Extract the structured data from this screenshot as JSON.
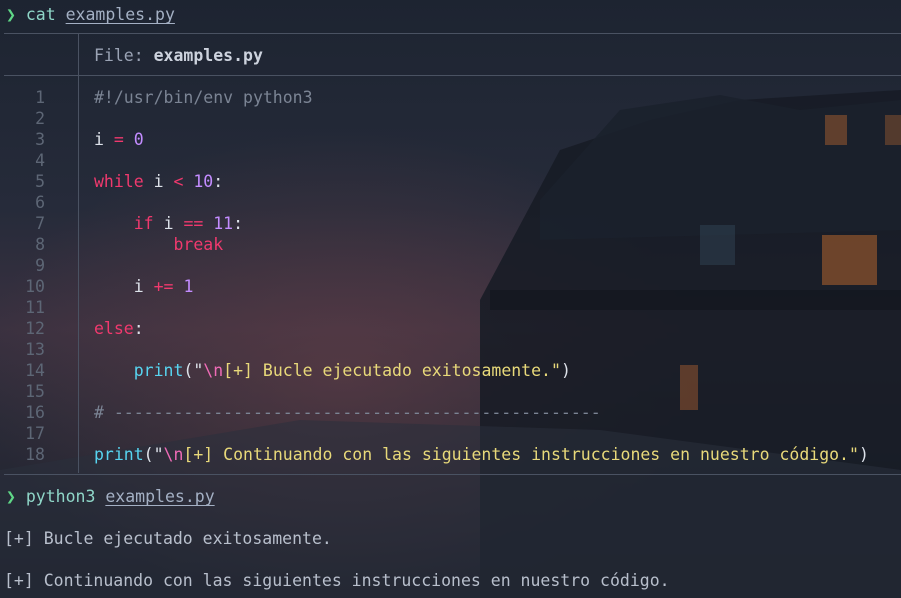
{
  "colors": {
    "prompt_arrow": "#5fd787",
    "keyword": "#f0396e",
    "number": "#c38cff",
    "string": "#e8d97a",
    "function": "#57d4f0",
    "comment": "#7b8494"
  },
  "prompt_symbol": "❯",
  "command1": {
    "cmd": "cat",
    "arg": "examples.py"
  },
  "file_header": {
    "label": "File: ",
    "name": "examples.py"
  },
  "line_numbers": [
    "1",
    "2",
    "3",
    "4",
    "5",
    "6",
    "7",
    "8",
    "9",
    "10",
    "11",
    "12",
    "13",
    "14",
    "15",
    "16",
    "17",
    "18"
  ],
  "code": {
    "l1": "#!/usr/bin/env python3",
    "l3_var": "i",
    "l3_op": "=",
    "l3_num": "0",
    "l5_kw": "while",
    "l5_var": "i",
    "l5_op": "<",
    "l5_num": "10",
    "l5_colon": ":",
    "l7_kw": "if",
    "l7_var": "i",
    "l7_op": "==",
    "l7_num": "11",
    "l7_colon": ":",
    "l8_kw": "break",
    "l10_var": "i",
    "l10_op": "+=",
    "l10_num": "1",
    "l12_kw": "else",
    "l12_colon": ":",
    "l14_fn": "print",
    "l14_open": "(\"",
    "l14_esc": "\\n",
    "l14_str": "[+] Bucle ejecutado exitosamente.\"",
    "l14_close": ")",
    "l16": "# -------------------------------------------------",
    "l18_fn": "print",
    "l18_open": "(\"",
    "l18_esc": "\\n",
    "l18_str": "[+] Continuando con las siguientes instrucciones en nuestro código.\"",
    "l18_close": ")"
  },
  "command2": {
    "cmd": "python3",
    "arg": "examples.py"
  },
  "output": [
    "[+] Bucle ejecutado exitosamente.",
    "[+] Continuando con las siguientes instrucciones en nuestro código."
  ]
}
